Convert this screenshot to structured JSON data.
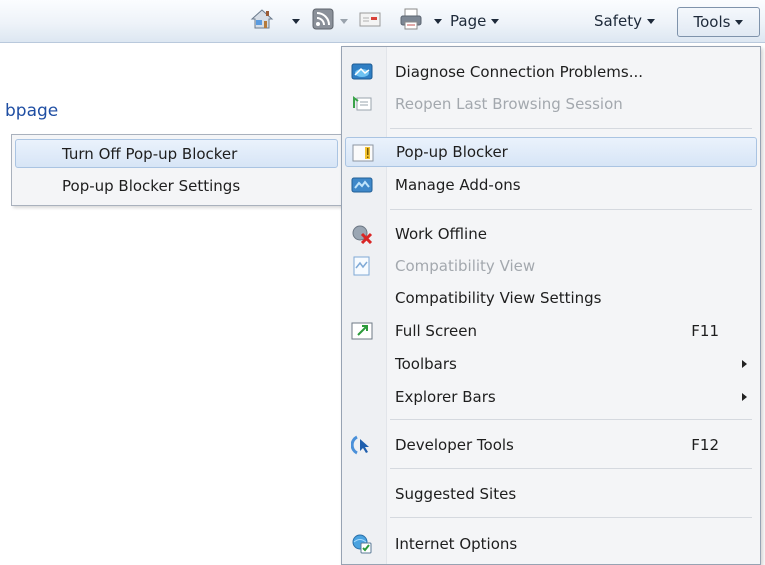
{
  "command_bar": {
    "home_icon": "home-icon",
    "feeds_icon": "rss-feed-icon",
    "mail_icon": "mail-icon",
    "print_icon": "printer-icon",
    "page_label": "Page",
    "safety_label": "Safety",
    "tools_label": "Tools"
  },
  "page": {
    "partial_link": "bpage"
  },
  "popup_submenu": {
    "items": [
      {
        "label": "Turn Off Pop-up Blocker"
      },
      {
        "label": "Pop-up Blocker Settings"
      }
    ]
  },
  "tools_menu": {
    "items": [
      {
        "label": "Diagnose Connection Problems...",
        "icon": "diagnose-icon"
      },
      {
        "label": "Reopen Last Browsing Session",
        "icon": "reopen-session-icon",
        "disabled": true
      },
      {
        "label": "Pop-up Blocker",
        "icon": "popup-blocker-icon",
        "highlighted": true
      },
      {
        "label": "Manage Add-ons",
        "icon": "add-ons-icon"
      },
      {
        "label": "Work Offline",
        "icon": "work-offline-icon"
      },
      {
        "label": "Compatibility View",
        "icon": "compatibility-view-icon",
        "disabled": true
      },
      {
        "label": "Compatibility View Settings"
      },
      {
        "label": "Full Screen",
        "icon": "full-screen-icon",
        "shortcut": "F11"
      },
      {
        "label": "Toolbars"
      },
      {
        "label": "Explorer Bars"
      },
      {
        "label": "Developer Tools",
        "icon": "developer-tools-icon",
        "shortcut": "F12"
      },
      {
        "label": "Suggested Sites"
      },
      {
        "label": "Internet Options",
        "icon": "internet-options-icon"
      }
    ]
  },
  "colors": {
    "highlight": "#d7e5f6",
    "menu_bg": "#f4f5f7",
    "link": "#1f4ea3",
    "disabled_text": "#a3a8ae"
  }
}
